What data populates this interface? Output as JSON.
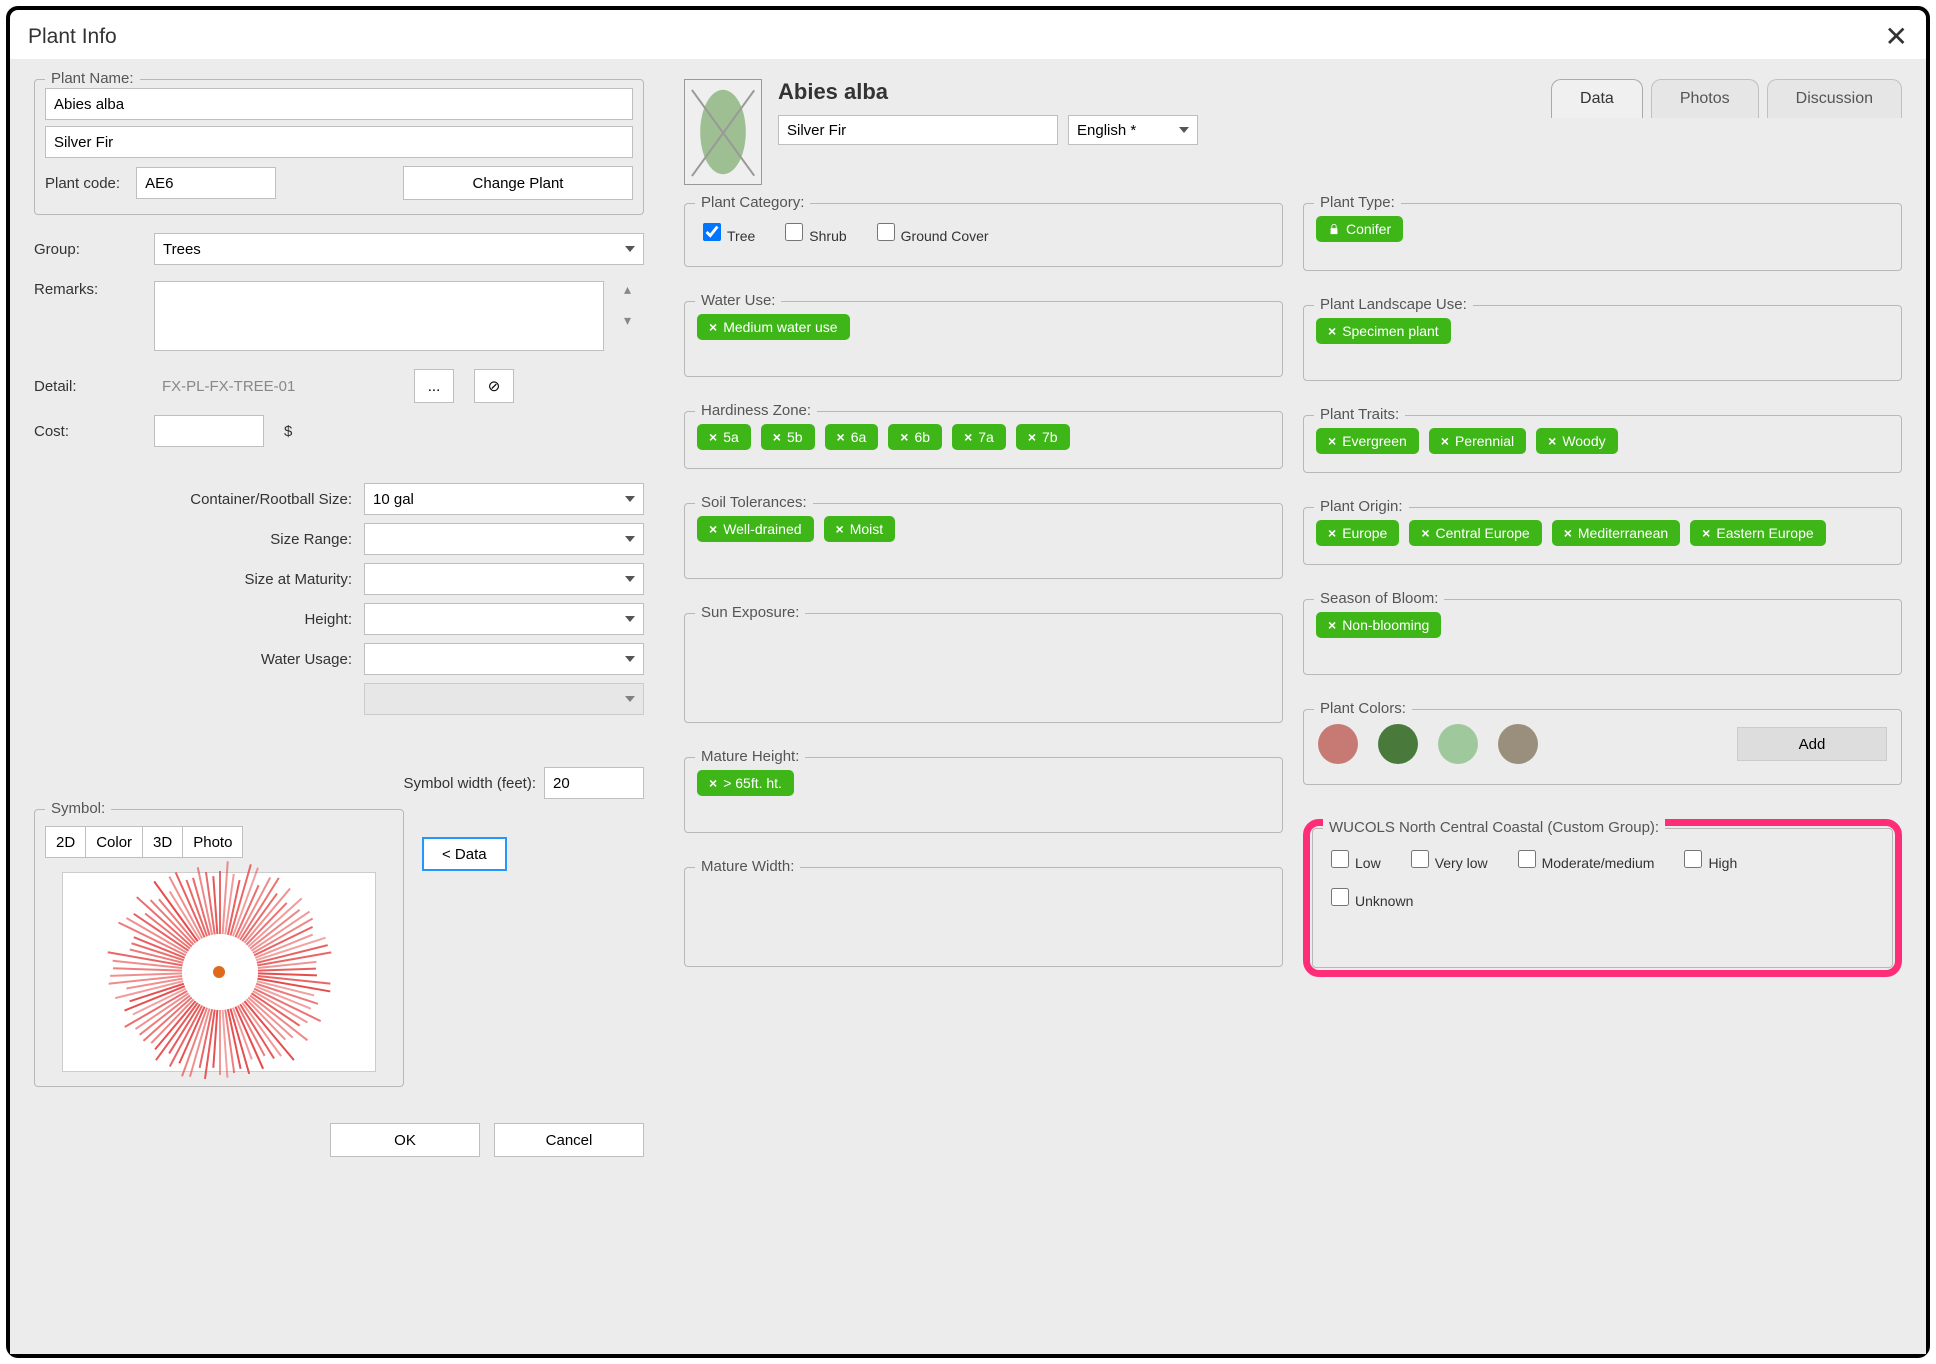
{
  "window_title": "Plant Info",
  "left": {
    "plant_name_label": "Plant Name:",
    "plant_name_value": "Abies alba",
    "common_name_value": "Silver Fir",
    "plant_code_label": "Plant code:",
    "plant_code_value": "AE6",
    "change_plant_btn": "Change Plant",
    "group_label": "Group:",
    "group_value": "Trees",
    "remarks_label": "Remarks:",
    "remarks_value": "",
    "detail_label": "Detail:",
    "detail_value": "FX-PL-FX-TREE-01",
    "ellipsis_btn": "...",
    "cost_label": "Cost:",
    "cost_value": "",
    "currency": "$",
    "container_label": "Container/Rootball Size:",
    "container_value": "10 gal",
    "size_range_label": "Size Range:",
    "size_range_value": "",
    "size_maturity_label": "Size at Maturity:",
    "size_maturity_value": "",
    "height_label": "Height:",
    "height_value": "",
    "water_usage_label": "Water Usage:",
    "water_usage_value": "",
    "symbol_width_label": "Symbol width (feet):",
    "symbol_width_value": "20",
    "symbol_label": "Symbol:",
    "symbol_tabs": {
      "t1": "2D",
      "t2": "Color",
      "t3": "3D",
      "t4": "Photo"
    },
    "data_back_btn": "< Data",
    "ok_btn": "OK",
    "cancel_btn": "Cancel"
  },
  "right": {
    "title": "Abies alba",
    "common_name_field": "Silver Fir",
    "language": "English *",
    "tabs": {
      "data": "Data",
      "photos": "Photos",
      "discussion": "Discussion"
    },
    "plant_category": {
      "legend": "Plant Category:",
      "tree": "Tree",
      "shrub": "Shrub",
      "ground": "Ground Cover"
    },
    "water_use": {
      "legend": "Water Use:",
      "tags": [
        "Medium water use"
      ]
    },
    "hardiness": {
      "legend": "Hardiness Zone:",
      "tags": [
        "5a",
        "5b",
        "6a",
        "6b",
        "7a",
        "7b"
      ]
    },
    "soil": {
      "legend": "Soil Tolerances:",
      "tags": [
        "Well-drained",
        "Moist"
      ]
    },
    "sun": {
      "legend": "Sun Exposure:",
      "tags": []
    },
    "mature_height": {
      "legend": "Mature Height:",
      "tags": [
        "> 65ft. ht."
      ]
    },
    "mature_width": {
      "legend": "Mature Width:",
      "tags": []
    },
    "plant_type": {
      "legend": "Plant Type:",
      "tag": "Conifer"
    },
    "landscape_use": {
      "legend": "Plant Landscape Use:",
      "tags": [
        "Specimen plant"
      ]
    },
    "traits": {
      "legend": "Plant Traits:",
      "tags": [
        "Evergreen",
        "Perennial",
        "Woody"
      ]
    },
    "origin": {
      "legend": "Plant Origin:",
      "tags": [
        "Europe",
        "Central Europe",
        "Mediterranean",
        "Eastern Europe"
      ]
    },
    "bloom": {
      "legend": "Season of Bloom:",
      "tags": [
        "Non-blooming"
      ]
    },
    "colors": {
      "legend": "Plant Colors:",
      "swatches": [
        "#c77a74",
        "#497a3b",
        "#9fc89d",
        "#9a8f7c"
      ],
      "add_btn": "Add"
    },
    "wucols": {
      "legend": "WUCOLS North Central Coastal (Custom Group):",
      "opts": {
        "low": "Low",
        "vlow": "Very low",
        "mod": "Moderate/medium",
        "high": "High",
        "unk": "Unknown"
      }
    }
  }
}
